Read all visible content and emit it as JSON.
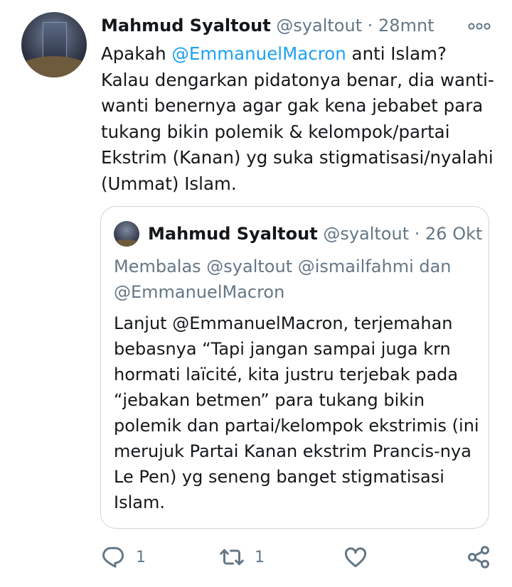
{
  "tweet": {
    "author_name": "Mahmud Syaltout",
    "author_handle": "@syaltout",
    "separator": "·",
    "time": "28mnt",
    "more_icon": "more-icon",
    "text_before": "Apakah ",
    "mention": "@EmmanuelMacron",
    "text_after": " anti Islam? Kalau dengarkan pidatonya benar, dia wanti-wanti benernya agar gak kena jebabet para tukang bikin polemik & kelompok/partai Ekstrim (Kanan) yg suka stigmatisasi/nyalahi (Ummat) Islam."
  },
  "quoted": {
    "author_name": "Mahmud Syaltout",
    "author_handle": "@syaltout",
    "separator": "·",
    "time": "26 Okt",
    "reply_line": "Membalas @syaltout @ismailfahmi dan @EmmanuelMacron",
    "text": "Lanjut @EmmanuelMacron, terjemahan bebasnya “Tapi jangan sampai juga krn hormati laïcité, kita justru terjebak pada “jebakan betmen” para tukang bikin polemik dan partai/kelompok ekstrimis (ini merujuk Partai Kanan ekstrim Prancis-nya Le Pen) yg seneng banget stigmatisasi Islam."
  },
  "actions": {
    "reply_count": "1",
    "retweet_count": "1",
    "icons": [
      "reply-icon",
      "retweet-icon",
      "like-icon",
      "share-icon"
    ]
  },
  "colors": {
    "link": "#1da1f2",
    "secondary": "#657786",
    "text": "#14171a",
    "border": "#ccd6dd"
  }
}
